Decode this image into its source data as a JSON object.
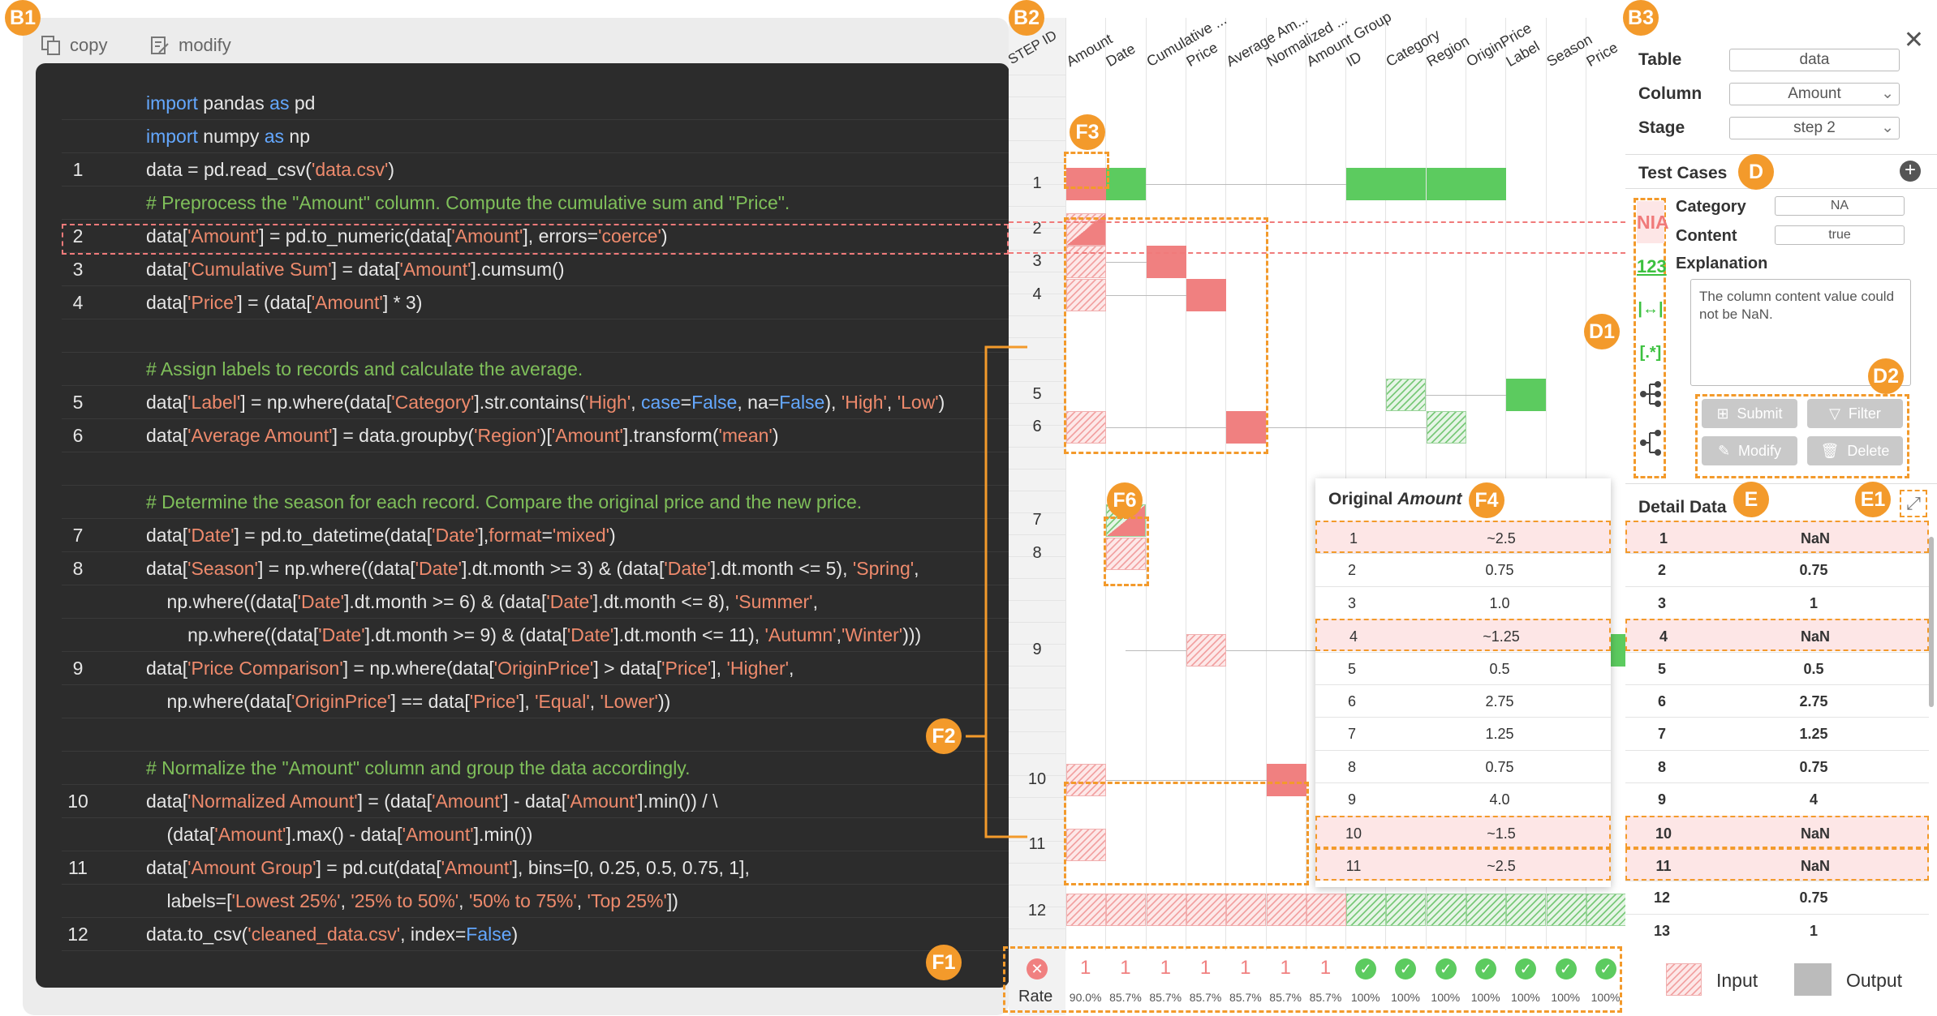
{
  "badges": {
    "b1": "B1",
    "b2": "B2",
    "b3": "B3",
    "d": "D",
    "d1": "D1",
    "d2": "D2",
    "e": "E",
    "e1": "E1",
    "f1": "F1",
    "f2": "F2",
    "f3": "F3",
    "f4": "F4",
    "f6": "F6"
  },
  "toolbar": {
    "copy_label": "copy",
    "modify_label": "modify"
  },
  "code": [
    {
      "num": "",
      "html": "<span class='kw'>import</span> pandas <span class='kw'>as</span> pd"
    },
    {
      "num": "",
      "html": "<span class='kw'>import</span> numpy <span class='kw'>as</span> np"
    },
    {
      "num": "1",
      "html": "data = pd.read_csv(<span class='st'>'data.csv'</span>)"
    },
    {
      "num": "",
      "html": "<span class='cm'># Preprocess the \"Amount\" column. Compute the cumulative sum and \"Price\".</span>"
    },
    {
      "num": "2",
      "html": "data[<span class='st'>'Amount'</span>] = pd.to_numeric(data[<span class='st'>'Amount'</span>], errors=<span class='st'>'coerce'</span>)"
    },
    {
      "num": "3",
      "html": "data[<span class='st'>'Cumulative Sum'</span>] = data[<span class='st'>'Amount'</span>].cumsum()"
    },
    {
      "num": "4",
      "html": "data[<span class='st'>'Price'</span>] = (data[<span class='st'>'Amount'</span>] * 3)"
    },
    {
      "num": "",
      "html": ""
    },
    {
      "num": "",
      "html": "<span class='cm'># Assign labels to records and calculate the average.</span>"
    },
    {
      "num": "5",
      "html": "data[<span class='st'>'Label'</span>] = np.where(data[<span class='st'>'Category'</span>].str.contains(<span class='st'>'High'</span>, <span class='kw'>case</span>=<span class='fl'>False</span>, na=<span class='fl'>False</span>), <span class='st'>'High'</span>, <span class='st'>'Low'</span>)"
    },
    {
      "num": "6",
      "html": "data[<span class='st'>'Average Amount'</span>] = data.groupby(<span class='st'>'Region'</span>)[<span class='st'>'Amount'</span>].transform(<span class='st'>'mean'</span>)"
    },
    {
      "num": "",
      "html": ""
    },
    {
      "num": "",
      "html": "<span class='cm'># Determine the season for each record. Compare the original price and the new price.</span>"
    },
    {
      "num": "7",
      "html": "data[<span class='st'>'Date'</span>] = pd.to_datetime(data[<span class='st'>'Date'</span>],<span class='st'>format</span>=<span class='st'>'mixed'</span>)"
    },
    {
      "num": "8",
      "html": "data[<span class='st'>'Season'</span>] = np.where((data[<span class='st'>'Date'</span>].dt.month &gt;= 3) &amp; (data[<span class='st'>'Date'</span>].dt.month &lt;= 5), <span class='st'>'Spring'</span>,"
    },
    {
      "num": "",
      "html": "    np.where((data[<span class='st'>'Date'</span>].dt.month &gt;= 6) &amp; (data[<span class='st'>'Date'</span>].dt.month &lt;= 8), <span class='st'>'Summer'</span>,"
    },
    {
      "num": "",
      "html": "        np.where((data[<span class='st'>'Date'</span>].dt.month &gt;= 9) &amp; (data[<span class='st'>'Date'</span>].dt.month &lt;= 11), <span class='st'>'Autumn'</span>,<span class='st'>'Winter'</span>)))"
    },
    {
      "num": "9",
      "html": "data[<span class='st'>'Price Comparison'</span>] = np.where(data[<span class='st'>'OriginPrice'</span>] &gt; data[<span class='st'>'Price'</span>], <span class='st'>'Higher'</span>,"
    },
    {
      "num": "",
      "html": "    np.where(data[<span class='st'>'OriginPrice'</span>] == data[<span class='st'>'Price'</span>], <span class='st'>'Equal'</span>, <span class='st'>'Lower'</span>))"
    },
    {
      "num": "",
      "html": ""
    },
    {
      "num": "",
      "html": "<span class='cm'># Normalize the \"Amount\" column and group the data accordingly.</span>"
    },
    {
      "num": "10",
      "html": "data[<span class='st'>'Normalized Amount'</span>] = (data[<span class='st'>'Amount'</span>] - data[<span class='st'>'Amount'</span>].min()) / \\"
    },
    {
      "num": "",
      "html": "    (data[<span class='st'>'Amount'</span>].max() - data[<span class='st'>'Amount'</span>].min())"
    },
    {
      "num": "11",
      "html": "data[<span class='st'>'Amount Group'</span>] = pd.cut(data[<span class='st'>'Amount'</span>], bins=[0, 0.25, 0.5, 0.75, 1],"
    },
    {
      "num": "",
      "html": "    labels=[<span class='st'>'Lowest 25%'</span>, <span class='st'>'25% to 50%'</span>, <span class='st'>'50% to 75%'</span>, <span class='st'>'Top 25%'</span>])"
    },
    {
      "num": "12",
      "html": "data.to_csv(<span class='st'>'cleaned_data.csv'</span>, index=<span class='fl'>False</span>)"
    }
  ],
  "grid": {
    "step_id_header": "STEP ID",
    "columns": [
      "Amount",
      "Date",
      "Cumulative ...",
      "Price",
      "Average Am...",
      "Normalized ...",
      "Amount Group",
      "ID",
      "Category",
      "Region",
      "OriginPrice",
      "Label",
      "Season",
      "Price"
    ],
    "steps": [
      "1",
      "2",
      "3",
      "4",
      "5",
      "6",
      "7",
      "8",
      "9",
      "10",
      "11",
      "12"
    ],
    "counts": [
      "1",
      "1",
      "1",
      "1",
      "1",
      "1",
      "1"
    ],
    "rate_label": "Rate",
    "rates": [
      "90.0%",
      "85.7%",
      "85.7%",
      "85.7%",
      "85.7%",
      "85.7%",
      "85.7%",
      "100%",
      "100%",
      "100%",
      "100%",
      "100%",
      "100%",
      "100%"
    ],
    "colors": {
      "fail": "#f08080",
      "pass": "#5ccb5f",
      "accent": "#f39a2b"
    }
  },
  "original": {
    "title_prefix": "Original ",
    "title_col": "Amount",
    "rows": [
      [
        "1",
        "~2.5"
      ],
      [
        "2",
        "0.75"
      ],
      [
        "3",
        "1.0"
      ],
      [
        "4",
        "~1.25"
      ],
      [
        "5",
        "0.5"
      ],
      [
        "6",
        "2.75"
      ],
      [
        "7",
        "1.25"
      ],
      [
        "8",
        "0.75"
      ],
      [
        "9",
        "4.0"
      ],
      [
        "10",
        "~1.5"
      ],
      [
        "11",
        "~2.5"
      ]
    ]
  },
  "config": {
    "table_label": "Table",
    "table_value": "data",
    "column_label": "Column",
    "column_value": "Amount",
    "stage_label": "Stage",
    "stage_value": "step 2"
  },
  "tests": {
    "title": "Test Cases",
    "category_label": "Category",
    "category_value": "NA",
    "content_label": "Content",
    "content_value": "true",
    "explanation_label": "Explanation",
    "explanation_text": "The column content value could not be NaN.",
    "icons": [
      "NIA",
      "123",
      "|↔|",
      "[.*]"
    ],
    "submit": "Submit",
    "filter": "Filter",
    "modify": "Modify",
    "delete": "Delete"
  },
  "detail": {
    "title": "Detail Data",
    "rows": [
      [
        "1",
        "NaN"
      ],
      [
        "2",
        "0.75"
      ],
      [
        "3",
        "1"
      ],
      [
        "4",
        "NaN"
      ],
      [
        "5",
        "0.5"
      ],
      [
        "6",
        "2.75"
      ],
      [
        "7",
        "1.25"
      ],
      [
        "8",
        "0.75"
      ],
      [
        "9",
        "4"
      ],
      [
        "10",
        "NaN"
      ],
      [
        "11",
        "NaN"
      ],
      [
        "12",
        "0.75"
      ],
      [
        "13",
        "1"
      ]
    ]
  },
  "legend": {
    "input": "Input",
    "output": "Output"
  }
}
